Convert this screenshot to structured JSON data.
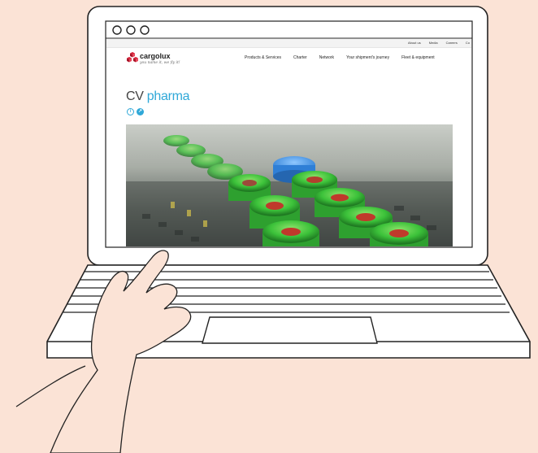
{
  "browser": {
    "window_buttons": [
      "close",
      "minimize",
      "maximize"
    ]
  },
  "site": {
    "brand": "cargolux",
    "tagline": "you name it, we fly it!",
    "top_nav": [
      "About us",
      "Media",
      "Careers",
      "Co"
    ],
    "main_nav": [
      "Products & Services",
      "Charter",
      "Network",
      "Your shipment's journey",
      "Fleet & equipment"
    ],
    "title_main": "CV",
    "title_accent": "pharma",
    "info_icon": "i",
    "share_icon": "↗"
  },
  "colors": {
    "background": "#fbe3d6",
    "accent": "#2fa8d8",
    "logo_red": "#d51f35",
    "vial_green": "#3cc23a",
    "vial_blue": "#2f7fd6"
  }
}
